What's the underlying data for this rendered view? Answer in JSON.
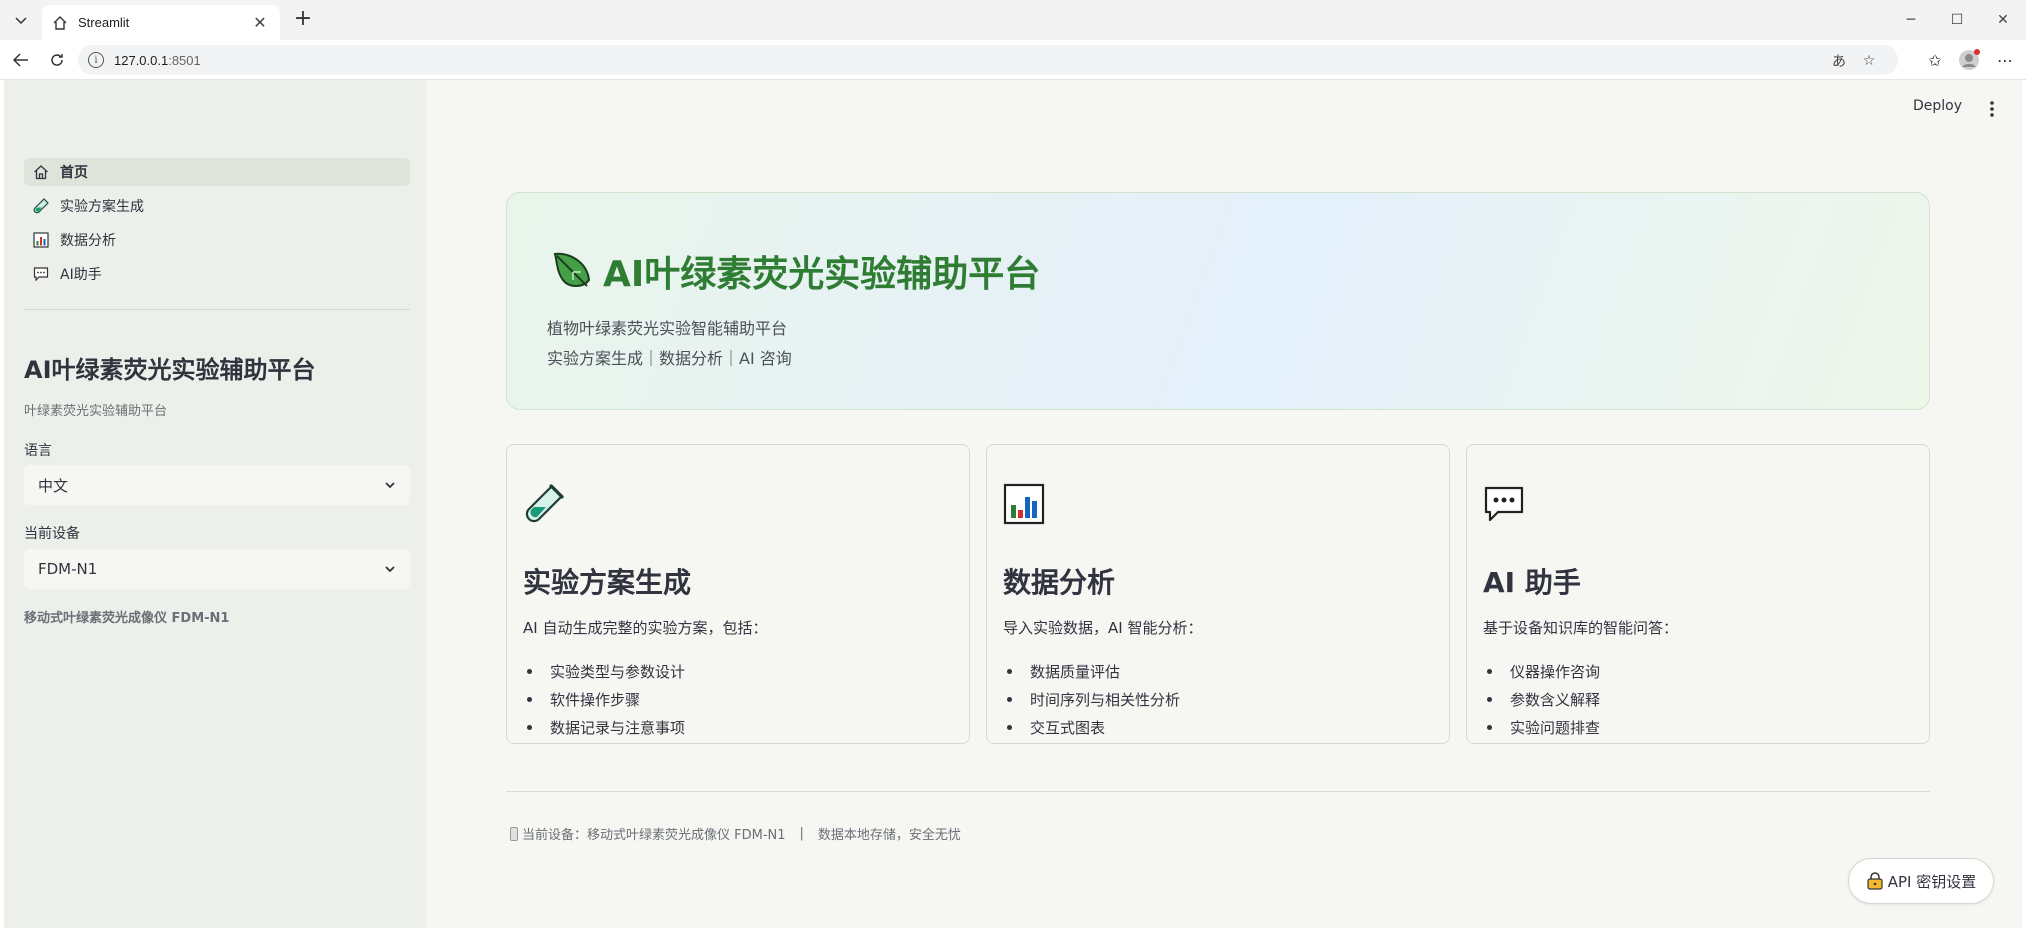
{
  "browser": {
    "tab_title": "Streamlit",
    "url_host": "127.0.0.1",
    "url_port": ":8501"
  },
  "sidebar": {
    "nav": [
      {
        "label": "首页",
        "icon": "home-icon",
        "active": true
      },
      {
        "label": "实验方案生成",
        "icon": "test-tube-icon",
        "active": false
      },
      {
        "label": "数据分析",
        "icon": "bar-chart-icon",
        "active": false
      },
      {
        "label": "AI助手",
        "icon": "chat-icon",
        "active": false
      }
    ],
    "title": "AI叶绿素荧光实验辅助平台",
    "subtitle": "叶绿素荧光实验辅助平台",
    "language_label": "语言",
    "language_value": "中文",
    "device_label": "当前设备",
    "device_value": "FDM-N1",
    "device_desc": "移动式叶绿素荧光成像仪 FDM-N1"
  },
  "header": {
    "deploy_label": "Deploy"
  },
  "hero": {
    "title": "AI叶绿素荧光实验辅助平台",
    "subtitle": "植物叶绿素荧光实验智能辅助平台",
    "tagline": "实验方案生成｜数据分析｜AI 咨询"
  },
  "cards": [
    {
      "icon": "test-tube-icon",
      "title": "实验方案生成",
      "desc": "AI 自动生成完整的实验方案，包括：",
      "items": [
        "实验类型与参数设计",
        "软件操作步骤",
        "数据记录与注意事项"
      ]
    },
    {
      "icon": "bar-chart-icon",
      "title": "数据分析",
      "desc": "导入实验数据，AI 智能分析：",
      "items": [
        "数据质量评估",
        "时间序列与相关性分析",
        "交互式图表"
      ]
    },
    {
      "icon": "chat-icon",
      "title": "AI 助手",
      "desc": "基于设备知识库的智能问答：",
      "items": [
        "仪器操作咨询",
        "参数含义解释",
        "实验问题排查"
      ]
    }
  ],
  "footer": {
    "device_text": "当前设备：移动式叶绿素荧光成像仪 FDM-N1",
    "separator": "|",
    "storage_text": "数据本地存储，安全无忧"
  },
  "api_button": {
    "label": "API 密钥设置"
  },
  "colors": {
    "accent_green": "#2e7d32",
    "sidebar_bg": "#edf0ea",
    "main_bg": "#f6f7f3"
  }
}
